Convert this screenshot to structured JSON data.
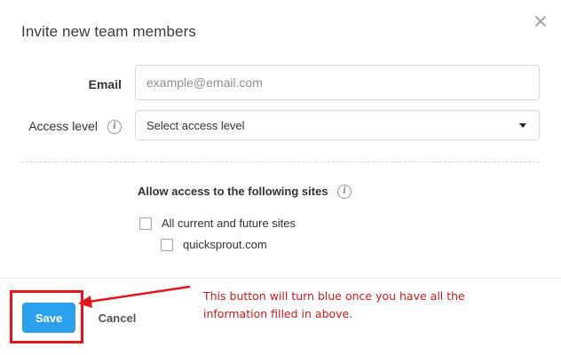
{
  "dialog": {
    "title": "Invite new team members",
    "close_icon": "close-icon"
  },
  "form": {
    "email_label": "Email",
    "email_placeholder": "example@email.com",
    "email_value": "",
    "access_label": "Access level",
    "access_selected": "Select access level",
    "info_icon": "info-icon"
  },
  "sites": {
    "heading": "Allow access to the following sites",
    "options": [
      {
        "label": "All current and future sites",
        "checked": false
      },
      {
        "label": "quicksprout.com",
        "checked": false
      }
    ]
  },
  "footer": {
    "save_label": "Save",
    "cancel_label": "Cancel"
  },
  "annotation": {
    "text": "This button will turn blue once you have all the information filled in above.",
    "color": "#cc1a1a"
  },
  "colors": {
    "primary": "#2aa1ec",
    "highlight": "#e8141b",
    "border": "#d9d9d9"
  }
}
